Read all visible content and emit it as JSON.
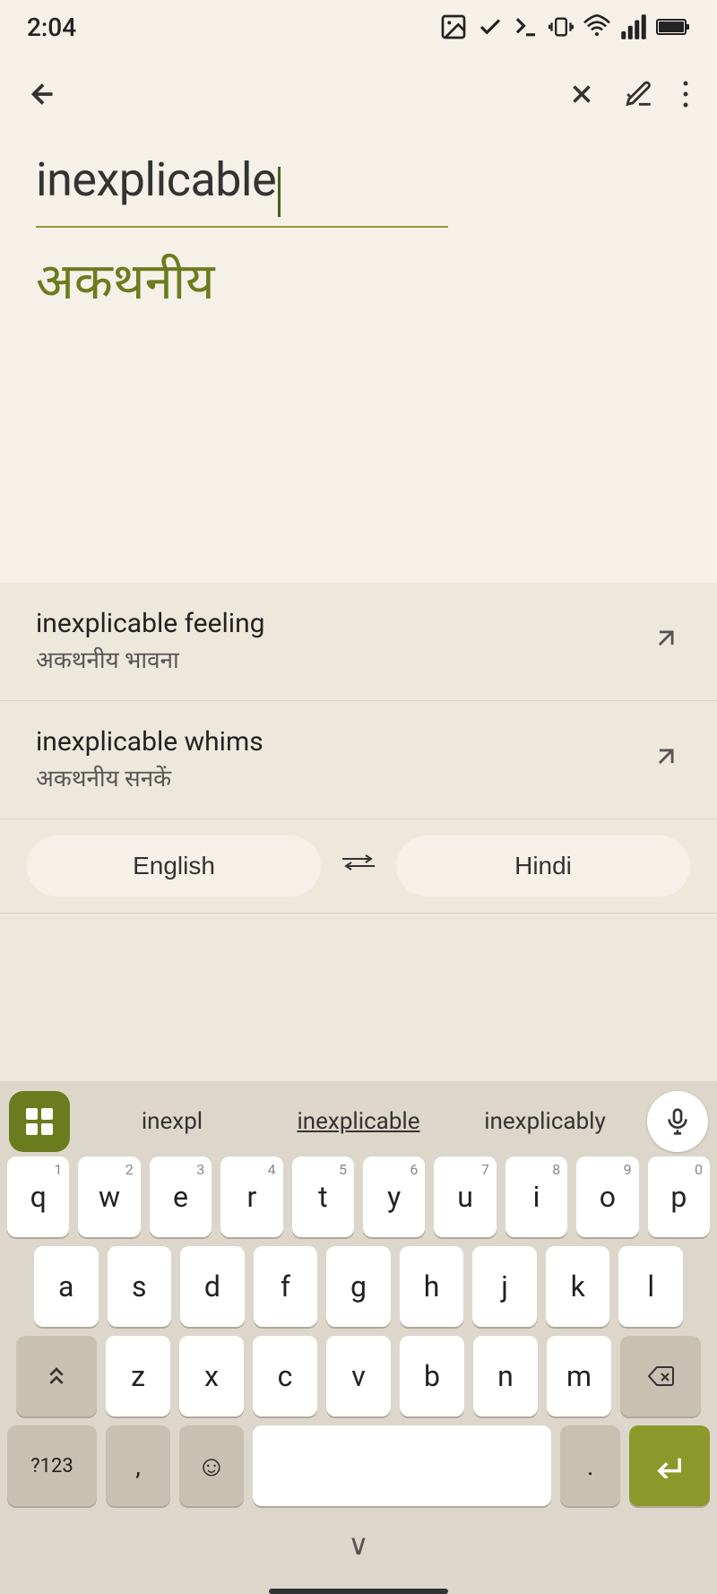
{
  "status": {
    "time": "2:04",
    "icons": [
      "gallery",
      "check",
      "terminal",
      "vibrate",
      "wifi",
      "signal",
      "battery"
    ]
  },
  "toolbar": {
    "back_label": "←",
    "close_label": "×",
    "edit_label": "✏",
    "more_label": "⋮"
  },
  "source": {
    "text": "inexplicable"
  },
  "translated": {
    "text": "अकथनीय"
  },
  "suggestions": [
    {
      "main": "inexplicable feeling",
      "sub": "अकथनीय भावना"
    },
    {
      "main": "inexplicable whims",
      "sub": "अकथनीय सनकें"
    }
  ],
  "lang_selector": {
    "source_lang": "English",
    "swap_icon": "⇔",
    "target_lang": "Hindi"
  },
  "keyboard": {
    "strip": {
      "words": [
        "inexpl",
        "inexplicable",
        "inexplicably"
      ]
    },
    "rows": [
      [
        {
          "char": "q",
          "num": "1"
        },
        {
          "char": "w",
          "num": "2"
        },
        {
          "char": "e",
          "num": "3"
        },
        {
          "char": "r",
          "num": "4"
        },
        {
          "char": "t",
          "num": "5"
        },
        {
          "char": "y",
          "num": "6"
        },
        {
          "char": "u",
          "num": "7"
        },
        {
          "char": "i",
          "num": "8"
        },
        {
          "char": "o",
          "num": "9"
        },
        {
          "char": "p",
          "num": "0"
        }
      ],
      [
        {
          "char": "a"
        },
        {
          "char": "s"
        },
        {
          "char": "d"
        },
        {
          "char": "f"
        },
        {
          "char": "g"
        },
        {
          "char": "h"
        },
        {
          "char": "j"
        },
        {
          "char": "k"
        },
        {
          "char": "l"
        }
      ],
      [
        {
          "char": "⇧",
          "special": true
        },
        {
          "char": "z"
        },
        {
          "char": "x"
        },
        {
          "char": "c"
        },
        {
          "char": "v"
        },
        {
          "char": "b"
        },
        {
          "char": "n"
        },
        {
          "char": "m"
        },
        {
          "char": "⌫",
          "special": true
        }
      ],
      [
        {
          "char": "?123",
          "special": "numbers"
        },
        {
          "char": ","
        },
        {
          "char": "😊",
          "special": "emoji"
        },
        {
          "char": "",
          "special": "space"
        },
        {
          "char": ".",
          "special": "dot"
        },
        {
          "char": "→",
          "special": "action"
        }
      ]
    ],
    "chevron": "∨"
  }
}
